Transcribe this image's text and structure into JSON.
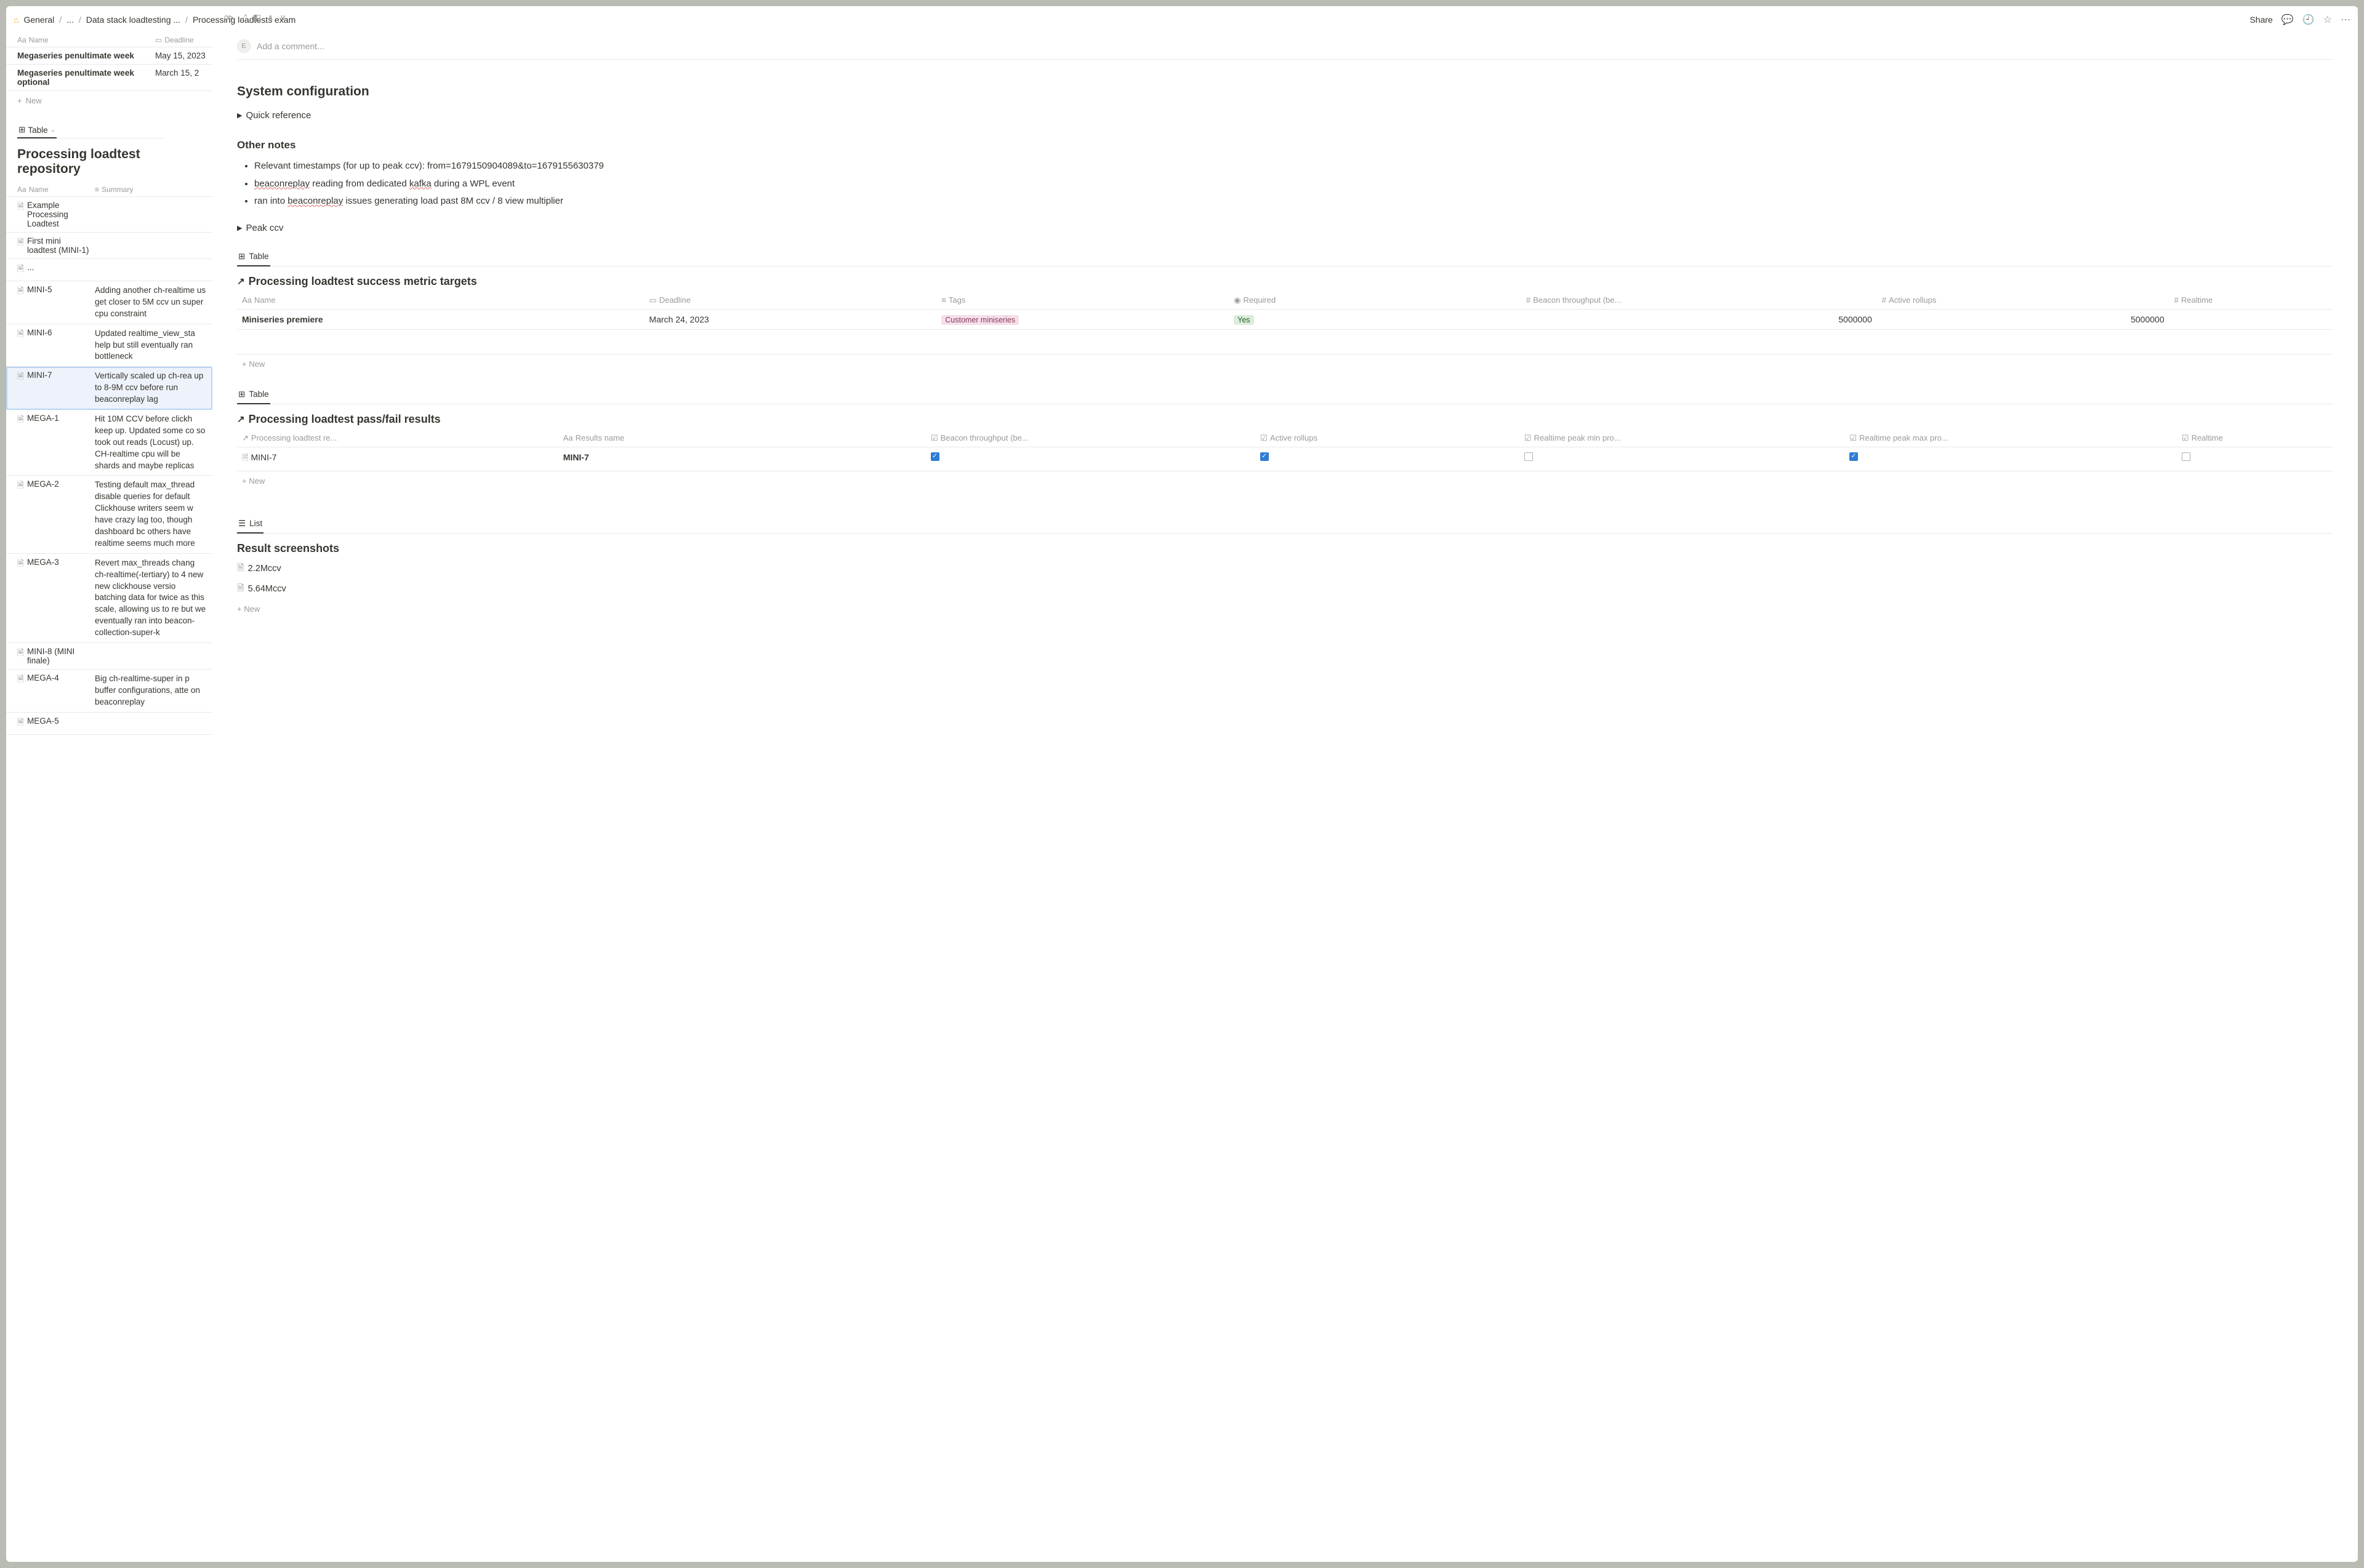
{
  "breadcrumbs": {
    "home_icon": "home",
    "items": [
      "General",
      "...",
      "Data stack loadtesting ...",
      "Processing loadtests exam"
    ]
  },
  "topbar": {
    "share": "Share"
  },
  "comment": {
    "avatar_initial": "E",
    "placeholder": "Add a comment..."
  },
  "side_top_table": {
    "columns": {
      "name": "Name",
      "deadline": "Deadline"
    },
    "rows": [
      {
        "name": "Megaseries penultimate week",
        "deadline": "May 15, 2023"
      },
      {
        "name": "Megaseries penultimate week optional",
        "deadline": "March 15, 2"
      }
    ],
    "new_label": "New"
  },
  "side_view_tab": "Table",
  "repo": {
    "title": "Processing loadtest repository",
    "columns": {
      "name": "Name",
      "summary": "Summary"
    },
    "rows": [
      {
        "name": "Example Processing Loadtest",
        "summary": ""
      },
      {
        "name": "First mini loadtest (MINI-1)",
        "summary": ""
      },
      {
        "name": "...",
        "summary": ""
      },
      {
        "name": "MINI-5",
        "summary": "Adding another ch-realtime us get closer to 5M ccv un super cpu constraint"
      },
      {
        "name": "MINI-6",
        "summary": "Updated realtime_view_sta help but still eventually ran bottleneck"
      },
      {
        "name": "MINI-7",
        "summary": "Vertically scaled up ch-rea up to 8-9M ccv before run beaconreplay lag"
      },
      {
        "name": "MEGA-1",
        "summary": "Hit 10M CCV before clickh keep up. Updated some co so took out reads (Locust) up. CH-realtime cpu will be shards and maybe replicas"
      },
      {
        "name": "MEGA-2",
        "summary": "Testing default max_thread disable queries for default Clickhouse writers seem w have crazy lag too, though dashboard bc others have realtime seems much more"
      },
      {
        "name": "MEGA-3",
        "summary": "Revert max_threads chang ch-realtime(-tertiary) to 4 new new clickhouse versio batching data for twice as this scale, allowing us to re but we eventually ran into beacon-collection-super-k"
      },
      {
        "name": "MINI-8 (MINI finale)",
        "summary": ""
      },
      {
        "name": "MEGA-4",
        "summary": "Big ch-realtime-super in p buffer configurations, atte on beaconreplay"
      },
      {
        "name": "MEGA-5",
        "summary": ""
      }
    ],
    "selected_index": 5
  },
  "main": {
    "h2_sysconfig": "System configuration",
    "toggle_quickref": "Quick reference",
    "h3_other": "Other notes",
    "notes": [
      {
        "pre": "Relevant timestamps (for up to peak ccv): from=1679150904089&to=1679155630379"
      },
      {
        "pre": "",
        "w1": "beaconreplay",
        "mid": " reading from dedicated ",
        "w2": "kafka",
        "post": " during a WPL event"
      },
      {
        "pre": "ran into ",
        "w1": "beaconreplay",
        "post": " issues generating load past 8M ccv / 8 view multiplier"
      }
    ],
    "toggle_peak": "Peak ccv",
    "table_tab": "Table",
    "targets": {
      "title": "Processing loadtest success metric targets",
      "cols": [
        "Name",
        "Deadline",
        "Tags",
        "Required",
        "Beacon throughput (be...",
        "Active rollups",
        "Realtime"
      ],
      "row": {
        "name": "Miniseries premiere",
        "deadline": "March 24, 2023",
        "tag": "Customer miniseries",
        "required": "Yes",
        "beacon": "5000000",
        "rollups": "5000000"
      },
      "new_label": "New"
    },
    "results": {
      "title": "Processing loadtest pass/fail results",
      "cols": [
        "Processing loadtest re...",
        "Results name",
        "Beacon throughput (be...",
        "Active rollups",
        "Realtime peak min pro...",
        "Realtime peak max pro...",
        "Realtime"
      ],
      "row": {
        "ref": "MINI-7",
        "name": "MINI-7",
        "beacon": true,
        "rollups": true,
        "peakmin": false,
        "peakmax": true,
        "realtime": false
      },
      "new_label": "New"
    },
    "list_tab": "List",
    "screenshots": {
      "title": "Result screenshots",
      "items": [
        "2.2Mccv",
        "5.64Mccv"
      ],
      "new_label": "New"
    }
  }
}
